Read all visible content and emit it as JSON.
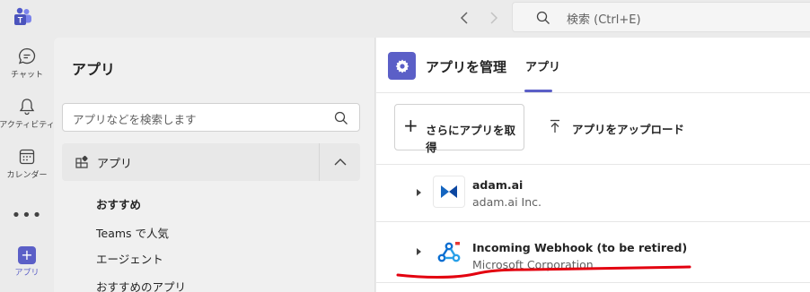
{
  "topbar": {
    "search_placeholder": "検索 (Ctrl+E)",
    "back_icon": "chevron-left-icon",
    "forward_icon": "chevron-right-icon"
  },
  "rail": {
    "items": [
      {
        "label": "チャット",
        "icon": "chat-icon"
      },
      {
        "label": "アクティビティ",
        "icon": "bell-icon"
      },
      {
        "label": "カレンダー",
        "icon": "calendar-icon"
      },
      {
        "label": "•••",
        "icon": "more-icon"
      },
      {
        "label": "アプリ",
        "icon": "apps-add-icon"
      }
    ]
  },
  "sidebar": {
    "title": "アプリ",
    "search_placeholder": "アプリなどを検索します",
    "section_label": "アプリ",
    "items": [
      {
        "label": "おすすめ"
      },
      {
        "label": "Teams で人気"
      },
      {
        "label": "エージェント"
      },
      {
        "label": "おすすめのアプリ"
      }
    ]
  },
  "main": {
    "title": "アプリを管理",
    "tab": "アプリ",
    "get_more_label": "さらにアプリを取得",
    "upload_label": "アプリをアップロード",
    "apps": [
      {
        "name": "adam.ai",
        "publisher": "adam.ai Inc."
      },
      {
        "name": "Incoming Webhook (to be retired)",
        "publisher": "Microsoft Corporation"
      }
    ]
  },
  "colors": {
    "accent": "#5b5fc7",
    "annotation": "#e3000f"
  }
}
